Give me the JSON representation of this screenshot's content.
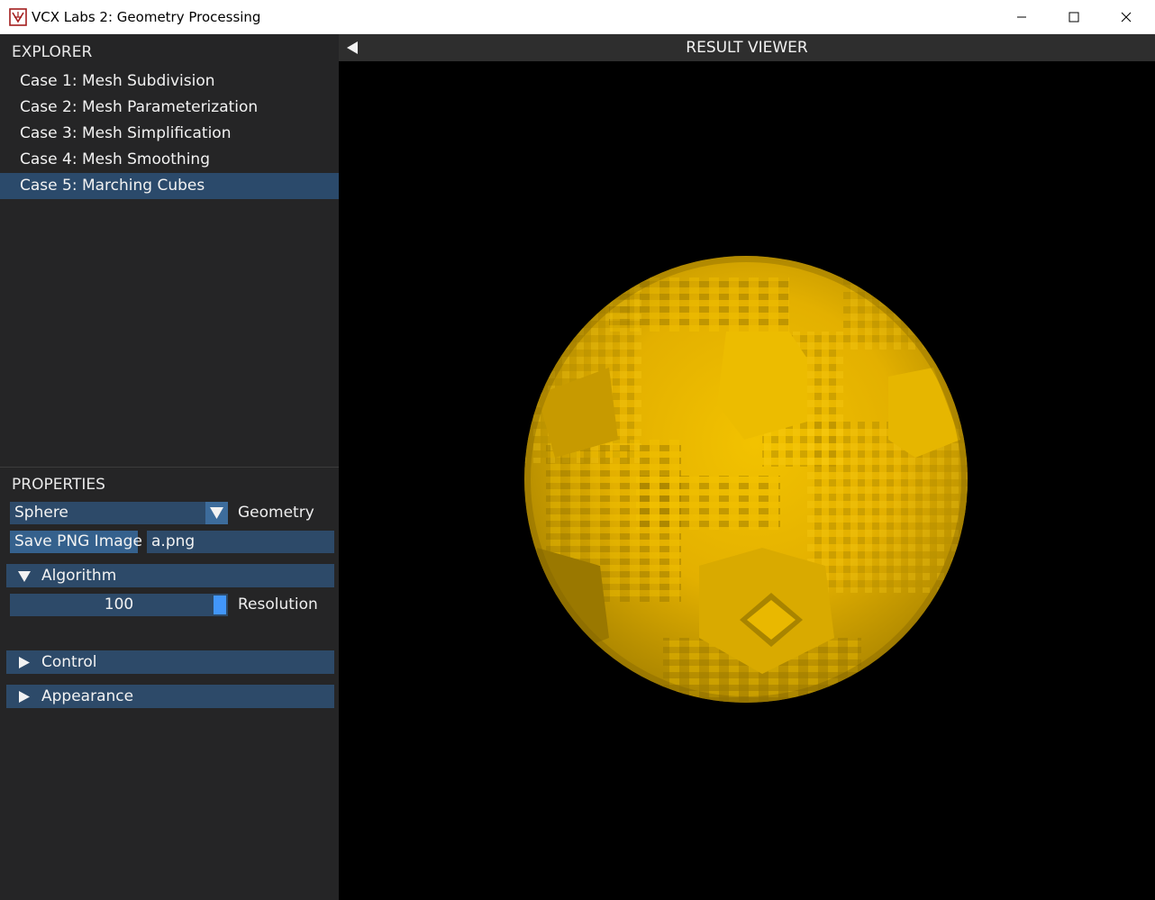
{
  "window": {
    "title": "VCX Labs 2: Geometry Processing",
    "icon": "app-logo-icon",
    "controls": [
      "minimize-icon",
      "maximize-icon",
      "close-icon"
    ]
  },
  "explorer": {
    "heading": "EXPLORER",
    "items": [
      {
        "label": "Case 1: Mesh Subdivision",
        "selected": false
      },
      {
        "label": "Case 2: Mesh Parameterization",
        "selected": false
      },
      {
        "label": "Case 3: Mesh Simplification",
        "selected": false
      },
      {
        "label": "Case 4: Mesh Smoothing",
        "selected": false
      },
      {
        "label": "Case 5: Marching Cubes",
        "selected": true
      }
    ]
  },
  "properties": {
    "heading": "PROPERTIES",
    "geometry": {
      "value": "Sphere",
      "label": "Geometry"
    },
    "save": {
      "button_label": "Save PNG Image",
      "filename": "a.png"
    },
    "sections": {
      "algorithm": {
        "label": "Algorithm",
        "expanded": true
      },
      "control": {
        "label": "Control",
        "expanded": false
      },
      "appearance": {
        "label": "Appearance",
        "expanded": false
      }
    },
    "resolution": {
      "value": "100",
      "label": "Resolution"
    }
  },
  "viewer": {
    "title": "RESULT VIEWER",
    "render": {
      "object": "voxelized sphere",
      "color": "#e8b400",
      "background": "#000000"
    }
  },
  "colors": {
    "panel_bg": "#252526",
    "selected_bg": "#2b4a6b",
    "frame_bg": "#2d4a69",
    "button_bg": "#35618d",
    "accent": "#4296f9"
  }
}
